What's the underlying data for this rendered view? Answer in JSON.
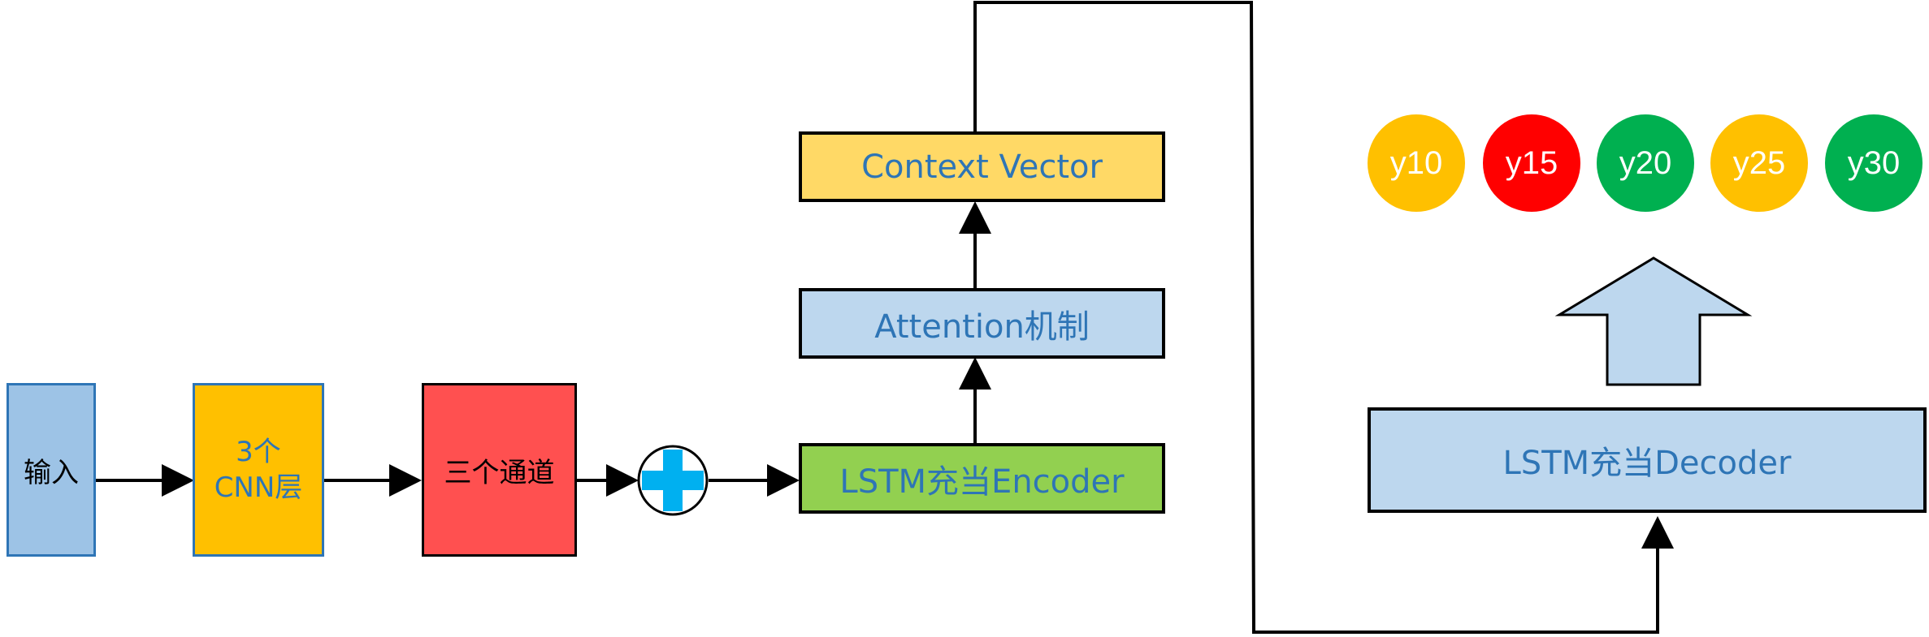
{
  "nodes": {
    "input": "输入",
    "cnn_line1": "3个",
    "cnn_line2": "CNN层",
    "channels": "三个通道",
    "encoder": "LSTM充当Encoder",
    "attention": "Attention机制",
    "context": "Context Vector",
    "decoder": "LSTM充当Decoder"
  },
  "outputs": [
    {
      "label": "y10",
      "color": "#FFC000"
    },
    {
      "label": "y15",
      "color": "#FF0000"
    },
    {
      "label": "y20",
      "color": "#00B050"
    },
    {
      "label": "y25",
      "color": "#FFC000"
    },
    {
      "label": "y30",
      "color": "#00B050"
    }
  ],
  "colors": {
    "input_fill": "#9DC3E6",
    "cnn_fill": "#FFC000",
    "channels_fill": "#FF5050",
    "encoder_fill": "#92D050",
    "attention_fill": "#BDD7EE",
    "context_fill": "#FFD966",
    "decoder_fill": "#BDD7EE",
    "plus_fill": "#00B0F0",
    "text_blue": "#2E75B6",
    "text_dark": "#000000"
  }
}
